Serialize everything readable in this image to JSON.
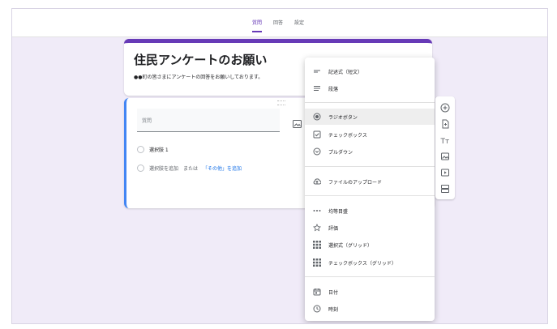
{
  "tabs": [
    {
      "label": "質問"
    },
    {
      "label": "回答"
    },
    {
      "label": "設定"
    }
  ],
  "form": {
    "title": "住民アンケートのお願い",
    "description": "●●町の皆さまにアンケートの回答をお願いしております。"
  },
  "question": {
    "placeholder": "質問",
    "option1": "選択肢 1",
    "add_option": "選択肢を追加",
    "or": "または",
    "add_other": "「その他」を追加"
  },
  "menu": {
    "items": [
      {
        "label": "記述式（短文）",
        "icon": "short-text-icon"
      },
      {
        "label": "段落",
        "icon": "paragraph-icon"
      },
      {
        "label": "ラジオボタン",
        "icon": "radio-button-icon",
        "selected": true
      },
      {
        "label": "チェックボックス",
        "icon": "checkbox-icon"
      },
      {
        "label": "プルダウン",
        "icon": "dropdown-icon"
      },
      {
        "label": "ファイルのアップロード",
        "icon": "upload-cloud-icon"
      },
      {
        "label": "均等目盛",
        "icon": "linear-scale-icon"
      },
      {
        "label": "評価",
        "icon": "star-icon"
      },
      {
        "label": "選択式（グリッド）",
        "icon": "grid-radio-icon"
      },
      {
        "label": "チェックボックス（グリッド）",
        "icon": "grid-checkbox-icon"
      },
      {
        "label": "日付",
        "icon": "calendar-icon"
      },
      {
        "label": "時刻",
        "icon": "clock-icon"
      }
    ]
  },
  "colors": {
    "accent": "#673ab7",
    "active_border": "#4285f4",
    "link": "#1a73e8",
    "background": "#f0ebf8"
  }
}
